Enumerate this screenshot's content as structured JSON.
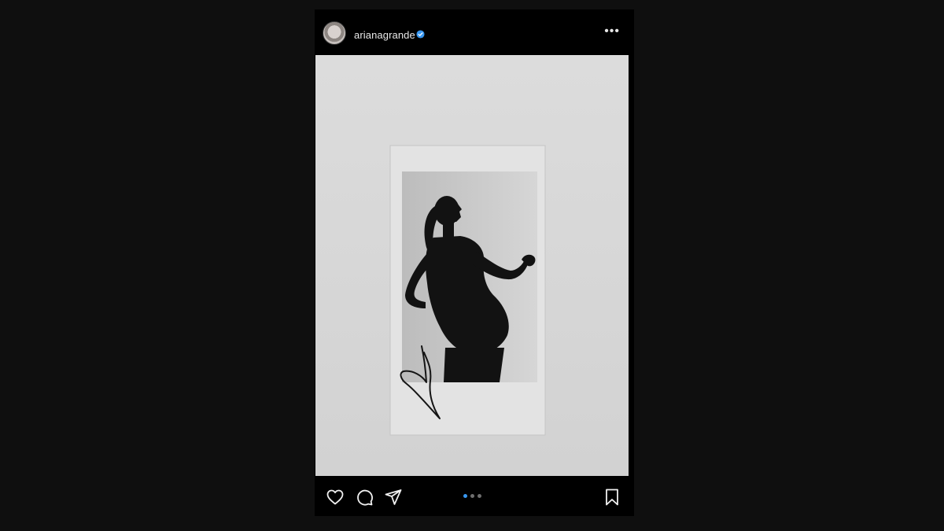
{
  "post": {
    "username": "arianagrande",
    "verified": true,
    "more_label": "•••"
  },
  "carousel": {
    "count": 3,
    "active_index": 0
  },
  "colors": {
    "background": "#0f0f0f",
    "post_bg": "#000000",
    "verified_blue": "#3897f0",
    "active_dot": "#3897f0",
    "inactive_dot": "#6e6e6e"
  },
  "icons": [
    "heart-icon",
    "comment-icon",
    "share-icon",
    "bookmark-icon",
    "verified-badge-icon",
    "more-options-icon"
  ]
}
